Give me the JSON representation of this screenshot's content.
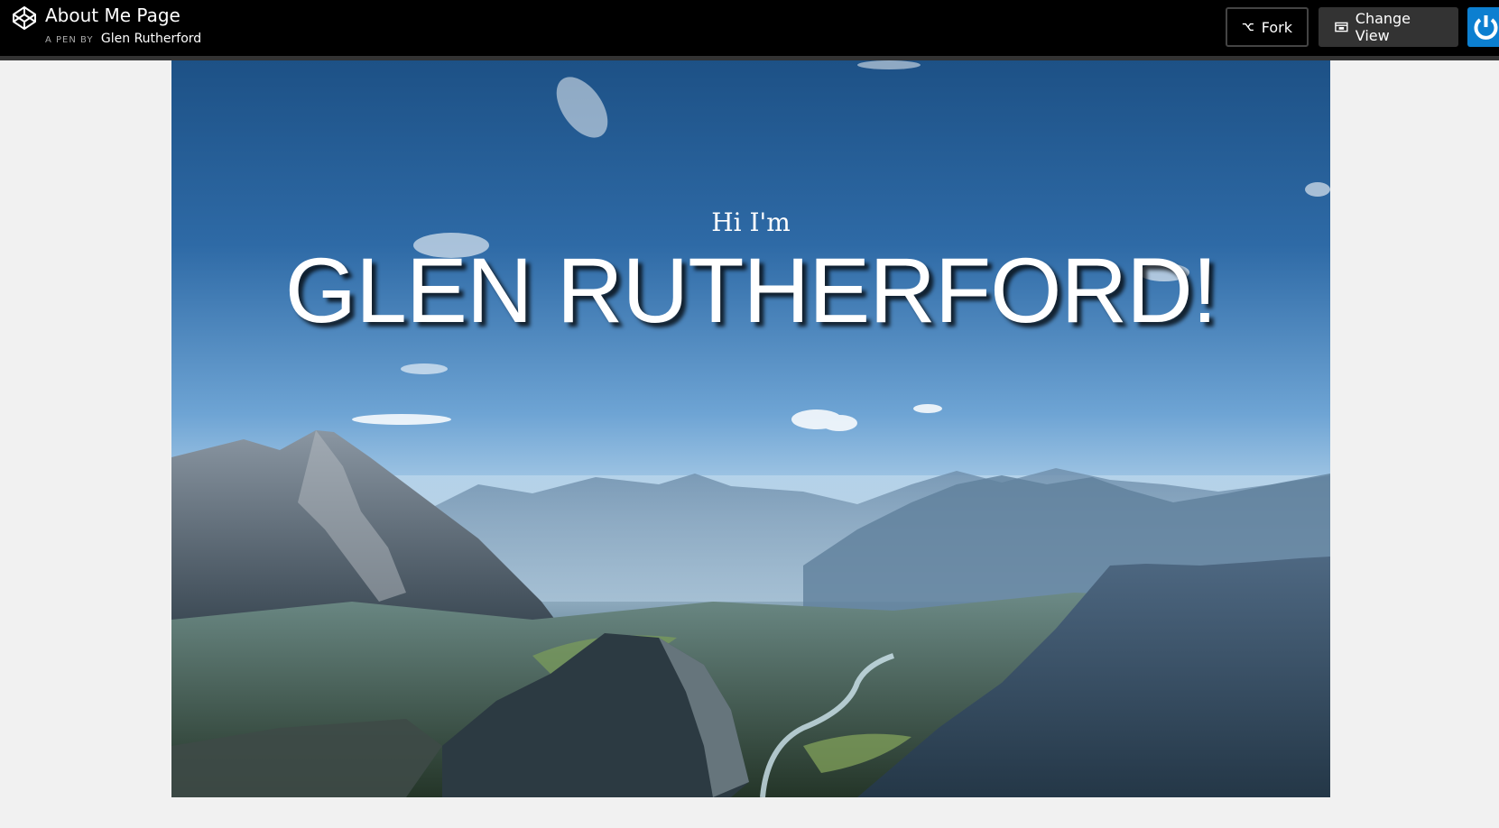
{
  "header": {
    "pen_title": "About Me Page",
    "pen_by_prefix": "A PEN BY",
    "author": "Glen Rutherford",
    "fork_label": "Fork",
    "change_view_label": "Change View",
    "logo_icon": "codepen-logo-icon",
    "fork_icon": "fork-icon",
    "change_view_icon": "window-icon",
    "power_icon": "power-icon"
  },
  "hero": {
    "greeting": "Hi I'm",
    "name": "GLEN RUTHERFORD!"
  },
  "colors": {
    "topbar": "#000000",
    "page_bg": "#f1f1f1",
    "accent_blue": "#0c7fd0"
  }
}
